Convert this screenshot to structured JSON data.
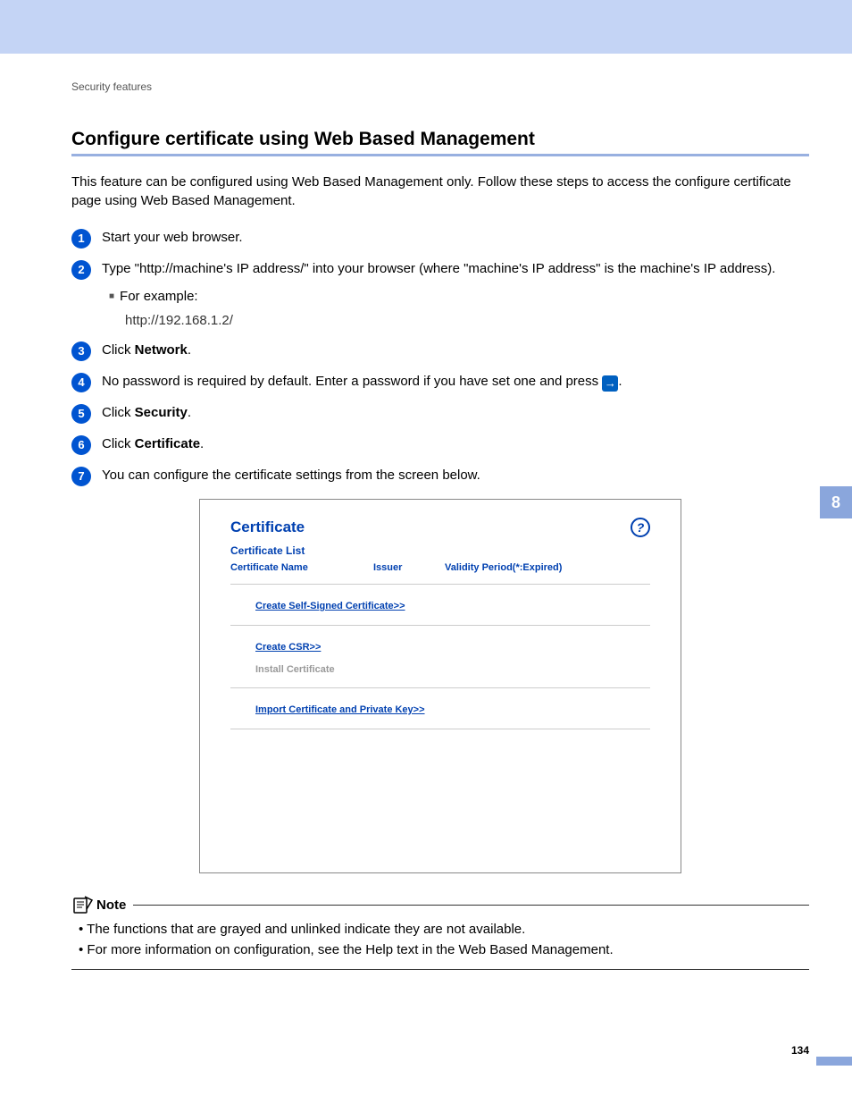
{
  "header": {
    "crumb": "Security features"
  },
  "title": "Configure certificate using Web Based Management",
  "intro": "This feature can be configured using Web Based Management only. Follow these steps to access the configure certificate page using Web Based Management.",
  "steps": {
    "s1": "Start your web browser.",
    "s2": "Type \"http://machine's IP address/\" into your browser (where \"machine's IP address\" is the machine's IP address).",
    "s2_example_label": "For example:",
    "s2_example_url": "http://192.168.1.2/",
    "s3_pre": "Click ",
    "s3_bold": "Network",
    "s3_post": ".",
    "s4_pre": "No password is required by default. Enter a password if you have set one and press ",
    "s4_post": ".",
    "s5_pre": "Click ",
    "s5_bold": "Security",
    "s5_post": ".",
    "s6_pre": "Click ",
    "s6_bold": "Certificate",
    "s6_post": ".",
    "s7": "You can configure the certificate settings from the screen below."
  },
  "panel": {
    "title": "Certificate",
    "list_heading": "Certificate List",
    "col_name": "Certificate Name",
    "col_issuer": "Issuer",
    "col_validity": "Validity Period(*:Expired)",
    "link_selfsigned": "Create Self-Signed Certificate>>",
    "link_csr": "Create CSR>>",
    "disabled_install": "Install Certificate",
    "link_import": "Import Certificate and Private Key>>"
  },
  "note": {
    "label": "Note",
    "items": [
      "The functions that are grayed and unlinked indicate they are not available.",
      "For more information on configuration, see the Help text in the Web Based Management."
    ]
  },
  "chapter_tab": "8",
  "page_number": "134"
}
